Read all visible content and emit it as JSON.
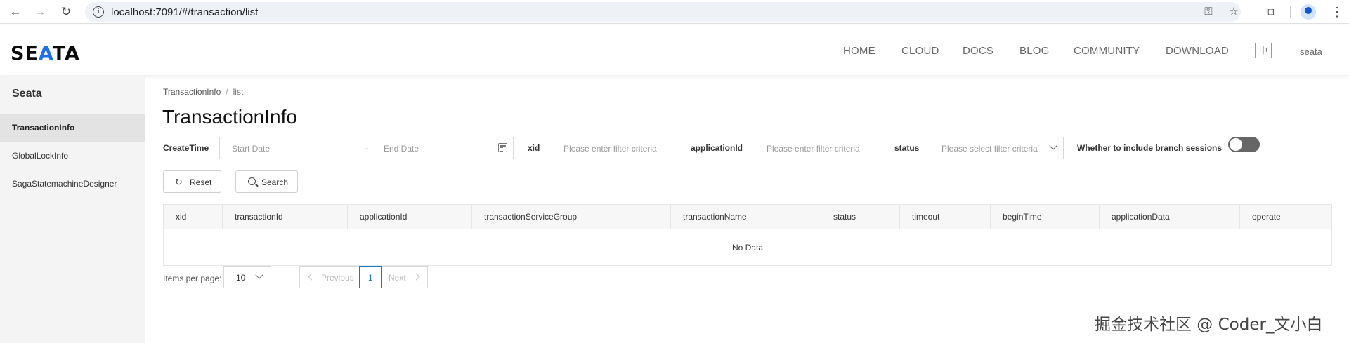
{
  "browser": {
    "url": "localhost:7091/#/transaction/list"
  },
  "header": {
    "nav": [
      "HOME",
      "CLOUD",
      "DOCS",
      "BLOG",
      "COMMUNITY",
      "DOWNLOAD"
    ],
    "lang_button": "中",
    "user": "seata"
  },
  "sidebar": {
    "title": "Seata",
    "items": [
      {
        "label": "TransactionInfo",
        "active": true
      },
      {
        "label": "GlobalLockInfo",
        "active": false
      },
      {
        "label": "SagaStatemachineDesigner",
        "active": false
      }
    ]
  },
  "breadcrumb": [
    "TransactionInfo",
    "list"
  ],
  "page_title": "TransactionInfo",
  "filters": {
    "create_time_label": "CreateTime",
    "start_placeholder": "Start Date",
    "range_separator": "-",
    "end_placeholder": "End Date",
    "xid_label": "xid",
    "xid_placeholder": "Please enter filter criteria",
    "application_label": "applicationId",
    "application_placeholder": "Please enter filter criteria",
    "status_label": "status",
    "status_placeholder": "Please select filter criteria",
    "branch_label": "Whether to include branch sessions",
    "branch_enabled": false
  },
  "actions": {
    "reset": "Reset",
    "search": "Search"
  },
  "table": {
    "columns": [
      "xid",
      "transactionId",
      "applicationId",
      "transactionServiceGroup",
      "transactionName",
      "status",
      "timeout",
      "beginTime",
      "applicationData",
      "operate"
    ],
    "empty_text": "No Data"
  },
  "pagination": {
    "items_per_page_label": "Items per page:",
    "items_per_page": "10",
    "previous": "Previous",
    "current_page": "1",
    "next": "Next"
  },
  "watermark": "掘金技术社区 @ Coder_文小白"
}
